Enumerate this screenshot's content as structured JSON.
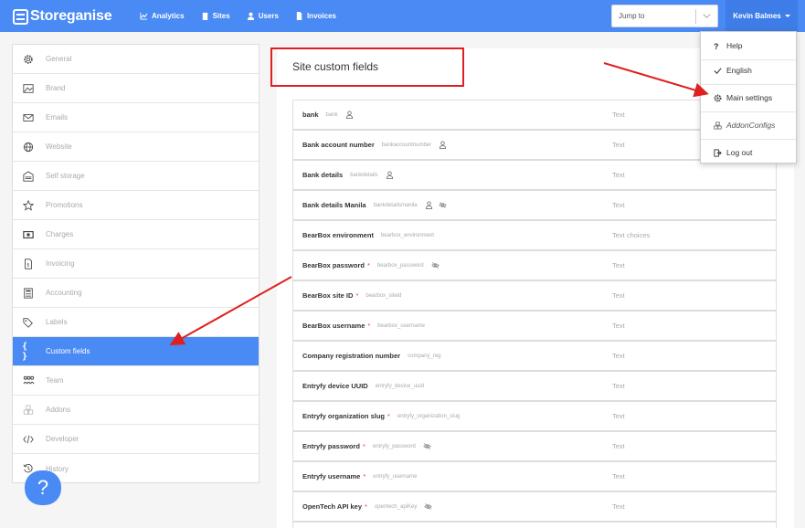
{
  "app": {
    "brand": "Storeganise"
  },
  "nav": {
    "links": [
      {
        "label": "Analytics",
        "icon": "chart-icon"
      },
      {
        "label": "Sites",
        "icon": "building-icon"
      },
      {
        "label": "Users",
        "icon": "user-icon"
      },
      {
        "label": "Invoices",
        "icon": "document-icon"
      }
    ],
    "jump_placeholder": "Jump to",
    "user_name": "Kevin Balmes"
  },
  "sidebar": {
    "items": [
      {
        "label": "General",
        "icon": "gear-icon"
      },
      {
        "label": "Brand",
        "icon": "image-icon"
      },
      {
        "label": "Emails",
        "icon": "envelope-icon"
      },
      {
        "label": "Website",
        "icon": "globe-icon"
      },
      {
        "label": "Self storage",
        "icon": "warehouse-icon"
      },
      {
        "label": "Promotions",
        "icon": "star-icon"
      },
      {
        "label": "Charges",
        "icon": "money-icon"
      },
      {
        "label": "Invoicing",
        "icon": "invoice-icon"
      },
      {
        "label": "Accounting",
        "icon": "calculator-icon"
      },
      {
        "label": "Labels",
        "icon": "tags-icon"
      },
      {
        "label": "Custom fields",
        "icon": "braces-icon"
      },
      {
        "label": "Team",
        "icon": "team-icon"
      },
      {
        "label": "Addons",
        "icon": "cubes-icon"
      },
      {
        "label": "Developer",
        "icon": "code-icon"
      },
      {
        "label": "History",
        "icon": "history-icon"
      }
    ],
    "active_index": 10
  },
  "main": {
    "title": "Site custom fields",
    "fields": [
      {
        "name": "bank",
        "code": "bank",
        "required": false,
        "icons": [
          "user-icon"
        ],
        "type": "Text"
      },
      {
        "name": "Bank account number",
        "code": "bankaccountnumber",
        "required": false,
        "icons": [
          "user-icon"
        ],
        "type": "Text"
      },
      {
        "name": "Bank details",
        "code": "bankdetails",
        "required": false,
        "icons": [
          "user-icon"
        ],
        "type": "Text"
      },
      {
        "name": "Bank details Manila",
        "code": "bankdetailsmanila",
        "required": false,
        "icons": [
          "user-icon",
          "eye-slash-icon"
        ],
        "type": "Text"
      },
      {
        "name": "BearBox environment",
        "code": "bearbox_environment",
        "required": false,
        "icons": [],
        "type": "Text choices"
      },
      {
        "name": "BearBox password",
        "code": "bearbox_password",
        "required": true,
        "icons": [
          "eye-slash-icon"
        ],
        "type": "Text"
      },
      {
        "name": "BearBox site ID",
        "code": "bearbox_siteid",
        "required": true,
        "icons": [],
        "type": "Text"
      },
      {
        "name": "BearBox username",
        "code": "bearbox_username",
        "required": true,
        "icons": [],
        "type": "Text"
      },
      {
        "name": "Company registration number",
        "code": "company_reg",
        "required": false,
        "icons": [],
        "type": "Text"
      },
      {
        "name": "Entryfy device UUID",
        "code": "entryfy_device_uuid",
        "required": false,
        "icons": [],
        "type": "Text"
      },
      {
        "name": "Entryfy organization slug",
        "code": "entryfy_organization_slug",
        "required": true,
        "icons": [],
        "type": "Text"
      },
      {
        "name": "Entryfy password",
        "code": "entryfy_password",
        "required": true,
        "icons": [
          "eye-slash-icon"
        ],
        "type": "Text"
      },
      {
        "name": "Entryfy username",
        "code": "entryfy_username",
        "required": true,
        "icons": [],
        "type": "Text"
      },
      {
        "name": "OpenTech API key",
        "code": "opentech_apiKey",
        "required": true,
        "icons": [
          "eye-slash-icon"
        ],
        "type": "Text"
      }
    ]
  },
  "dropdown": {
    "items": [
      {
        "label": "Help",
        "icon": "question-icon"
      },
      {
        "label": "English",
        "icon": "check-icon"
      },
      {
        "label": "Main settings",
        "icon": "gear-icon"
      },
      {
        "label": "AddonConfigs",
        "icon": "cubes-icon"
      },
      {
        "label": "Log out",
        "icon": "logout-icon"
      }
    ]
  },
  "help_button": {
    "label": "?"
  },
  "colors": {
    "primary": "#4a8af4",
    "annotation": "#e02020"
  }
}
